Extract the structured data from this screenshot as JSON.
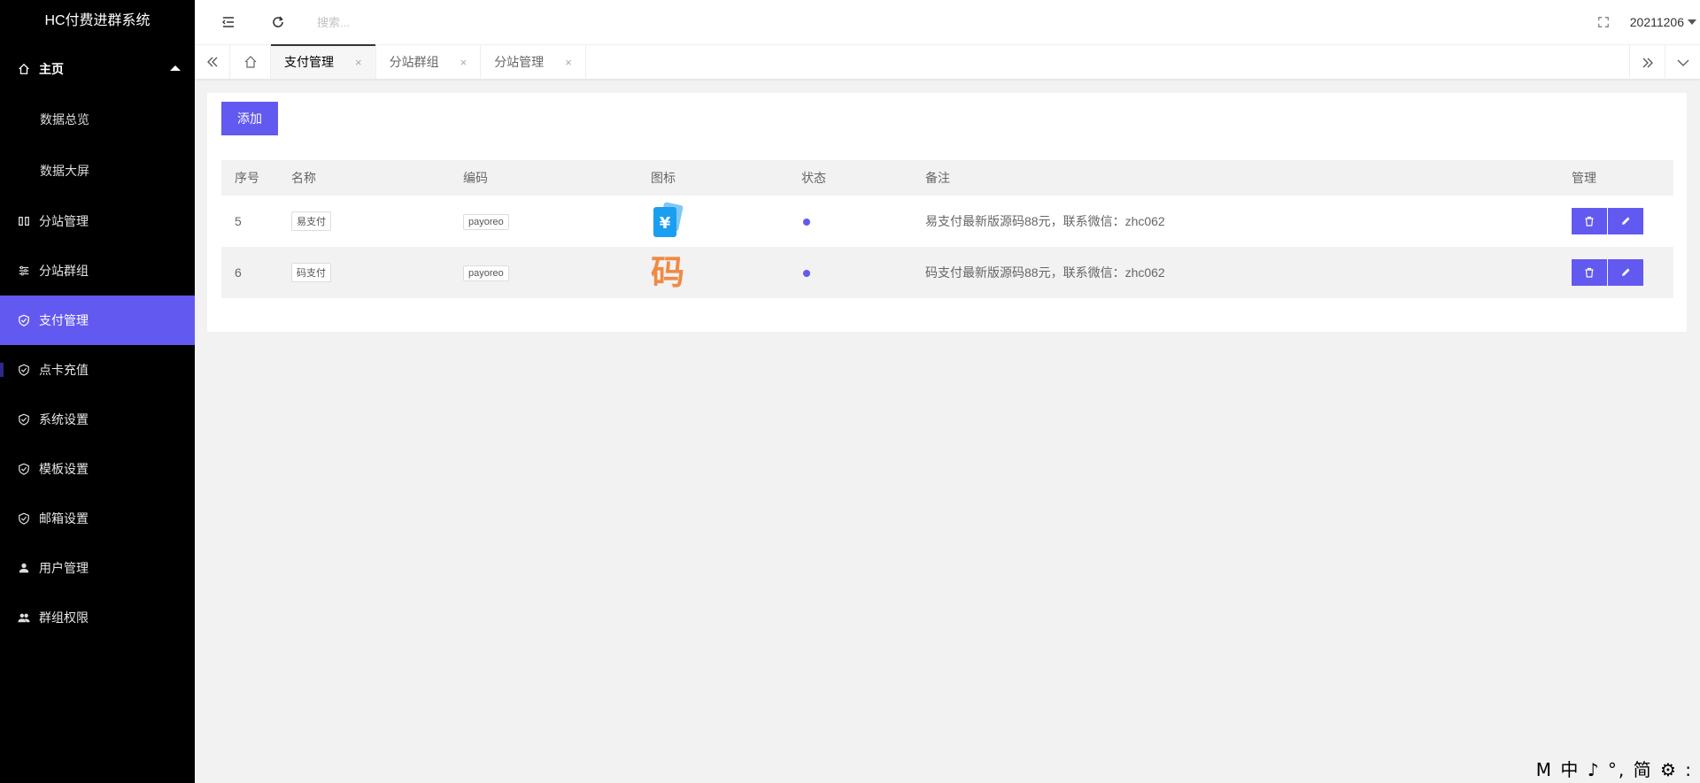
{
  "app": {
    "title": "HC付费进群系统"
  },
  "sidebar": {
    "home": {
      "label": "主页"
    },
    "home_subs": [
      {
        "label": "数据总览"
      },
      {
        "label": "数据大屏"
      }
    ],
    "items": [
      {
        "label": "分站管理",
        "icon": "columns-icon"
      },
      {
        "label": "分站群组",
        "icon": "sliders-icon"
      },
      {
        "label": "支付管理",
        "icon": "shield-check-icon"
      },
      {
        "label": "点卡充值",
        "icon": "shield-check-icon"
      },
      {
        "label": "系统设置",
        "icon": "shield-check-icon"
      },
      {
        "label": "模板设置",
        "icon": "shield-check-icon"
      },
      {
        "label": "邮箱设置",
        "icon": "shield-check-icon"
      },
      {
        "label": "用户管理",
        "icon": "user-icon"
      },
      {
        "label": "群组权限",
        "icon": "users-icon"
      }
    ]
  },
  "header": {
    "search_placeholder": "搜索...",
    "username": "20211206"
  },
  "tabs": [
    {
      "label": "支付管理",
      "close": "×"
    },
    {
      "label": "分站群组",
      "close": "×"
    },
    {
      "label": "分站管理",
      "close": "×"
    }
  ],
  "main": {
    "add_label": "添加",
    "columns": [
      "序号",
      "名称",
      "编码",
      "图标",
      "状态",
      "备注",
      "管理"
    ],
    "rows": [
      {
        "id": "5",
        "name": "易支付",
        "code": "payoreo",
        "icon": "yi-pay-icon",
        "note": "易支付最新版源码88元，联系微信：zhc062"
      },
      {
        "id": "6",
        "name": "码支付",
        "code": "payoreo",
        "icon": "ma-pay-icon",
        "note": "码支付最新版源码88元，联系微信：zhc062"
      }
    ]
  },
  "ime": {
    "text": "M 中 ♪ °, 简 ⚙ :"
  },
  "colors": {
    "accent": "#6259f0",
    "sidebar_bg": "#000000",
    "page_bg": "#f2f2f2"
  }
}
